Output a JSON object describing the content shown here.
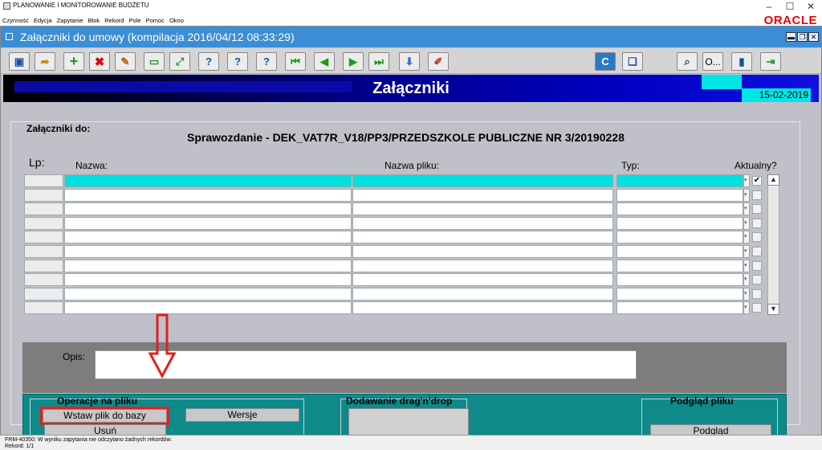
{
  "app": {
    "title": "PLANOWANIE I MONITOROWANIE BUDŻETU",
    "brand": "ORACLE"
  },
  "menu": [
    "Czynność",
    "Edycja",
    "Zapytanie",
    "Blok",
    "Rekord",
    "Pole",
    "Pomoc",
    "Okno"
  ],
  "window": {
    "title": "Załączniki do umowy (kompilacja 2016/04/12 08:33:29)"
  },
  "toolbar": {
    "o_label": "O..."
  },
  "banner": {
    "title": "Załączniki",
    "date": "15-02-2019"
  },
  "form": {
    "attach_label": "Załączniki do:",
    "attach_value": "Sprawozdanie - DEK_VAT7R_V18/PP3/PRZEDSZKOLE PUBLICZNE NR 3/20190228",
    "col_lp": "Lp:",
    "col_name": "Nazwa:",
    "col_file": "Nazwa pliku:",
    "col_type": "Typ:",
    "col_current": "Aktualny?",
    "rows": 10,
    "desc_label": "Opis:"
  },
  "ops": {
    "group_label": "Operacje na pliku",
    "insert_label": "Wstaw plik do bazy",
    "delete_label": "Usuń",
    "versions_label": "Wersje",
    "dragdrop_label": "Dodawanie drag'n'drop",
    "preview_group": "Podgląd pliku",
    "preview_label": "Podgląd"
  },
  "status": {
    "message": "FRM-40350: W wyniku zapytania nie odczytano żadnych rekordów.",
    "record": "Rekord: 1/1"
  },
  "colors": {
    "banner": "#00008a",
    "accent": "#00e6e6",
    "panel": "#0e8a8a",
    "highlight": "#e02020"
  }
}
